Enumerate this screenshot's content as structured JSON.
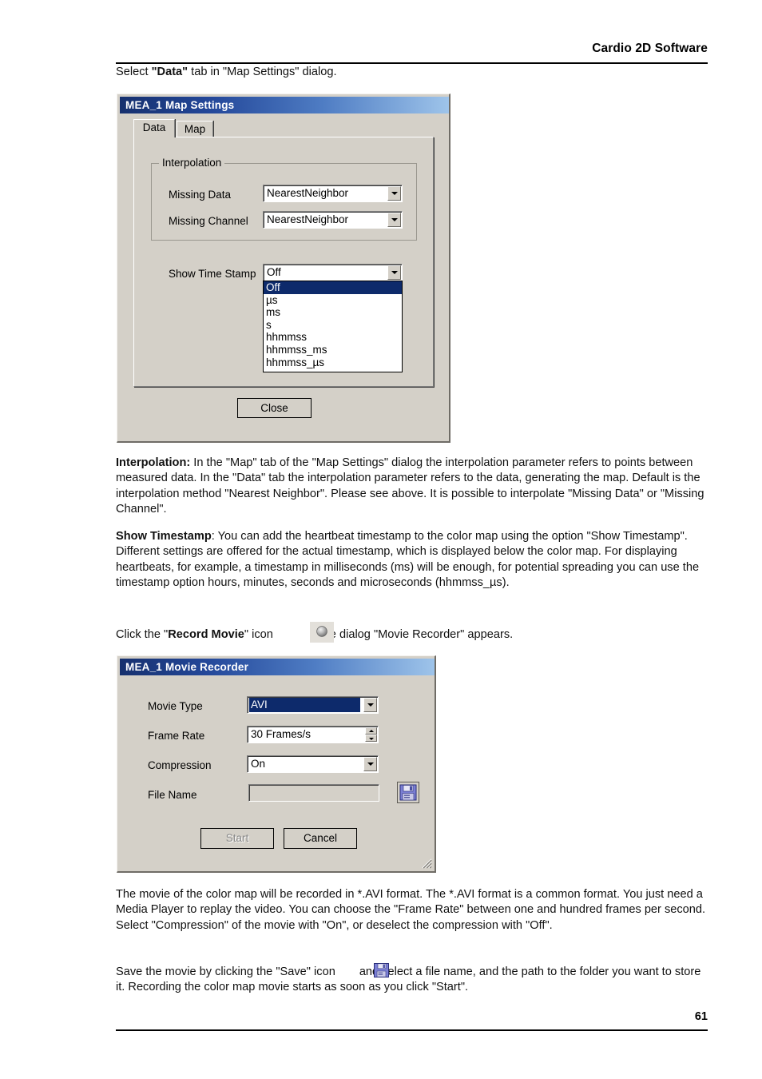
{
  "header": {
    "title": "Cardio 2D Software"
  },
  "intro": {
    "line_pre": "Select ",
    "line_bold": "\"Data\"",
    "line_post": " tab in \"Map Settings\" dialog."
  },
  "map_settings_dialog": {
    "title": "MEA_1  Map Settings",
    "tabs": [
      {
        "label": "Data",
        "active": true
      },
      {
        "label": "Map",
        "active": false
      }
    ],
    "interpolation": {
      "group_label": "Interpolation",
      "fields": [
        {
          "label": "Missing Data",
          "value": "NearestNeighbor"
        },
        {
          "label": "Missing Channel",
          "value": "NearestNeighbor"
        }
      ]
    },
    "time_stamp": {
      "label": "Show Time Stamp",
      "value": "Off",
      "options": [
        "Off",
        "µs",
        "ms",
        "s",
        "hhmmss",
        "hhmmss_ms",
        "hhmmss_µs"
      ],
      "selected_index": 0
    },
    "close_button": "Close"
  },
  "interpolation_para": {
    "bold": "Interpolation:",
    "text": " In the \"Map\" tab of the \"Map Settings\" dialog the interpolation parameter refers to points between measured data. In the \"Data\" tab the interpolation parameter refers to the data, generating the map. Default is the interpolation method \"Nearest Neighbor\". Please see above. It is possible to interpolate \"Missing Data\" or \"Missing Channel\"."
  },
  "timestamp_para": {
    "bold": "Show Timestamp",
    "text": ": You can add the heartbeat timestamp to the color map using the option \"Show Timestamp\". Different settings are offered for the actual timestamp, which is displayed below the color map. For displaying heartbeats, for example, a timestamp in milliseconds (ms) will be enough, for potential spreading you can use the timestamp option hours, minutes, seconds and microseconds (hhmmss_µs)."
  },
  "record_para": {
    "pre": "Click the \"",
    "bold": "Record Movie",
    "mid": "\" icon",
    "icon_name": "record-movie-icon",
    "post": ". The dialog \"Movie Recorder\" appears."
  },
  "movie_recorder_dialog": {
    "title": "MEA_1  Movie Recorder",
    "fields": [
      {
        "label": "Movie Type",
        "value": "AVI",
        "control": "combo-selected"
      },
      {
        "label": "Frame Rate",
        "value": "30 Frames/s",
        "control": "spinner"
      },
      {
        "label": "Compression",
        "value": "On",
        "control": "combo"
      },
      {
        "label": "File Name",
        "value": "",
        "control": "text"
      }
    ],
    "save_icon_name": "save-floppy-icon",
    "buttons": {
      "start": "Start",
      "start_disabled": true,
      "cancel": "Cancel"
    }
  },
  "avi_para": {
    "text": "The movie of the color map will be recorded in *.AVI format. The *.AVI format is a common format. You just need a Media Player to replay the video. You can choose the \"Frame Rate\" between one and hundred frames per second. Select \"Compression\" of the movie with \"On\", or deselect the compression with \"Off\"."
  },
  "save_para": {
    "pre": "Save the movie by clicking the \"Save\" icon",
    "post": "and select a file name, and the path to the folder you want to store it. Recording the color map movie starts as soon as you click \"Start\"."
  },
  "footer": {
    "page_number": "61"
  },
  "colors": {
    "titlebar_dark": "#16306e",
    "titlebar_light": "#9ec4ea",
    "dialog_face": "#d4d0c8",
    "selection_blue": "#0d2a6b",
    "save_icon_blue": "#6f74c8"
  }
}
